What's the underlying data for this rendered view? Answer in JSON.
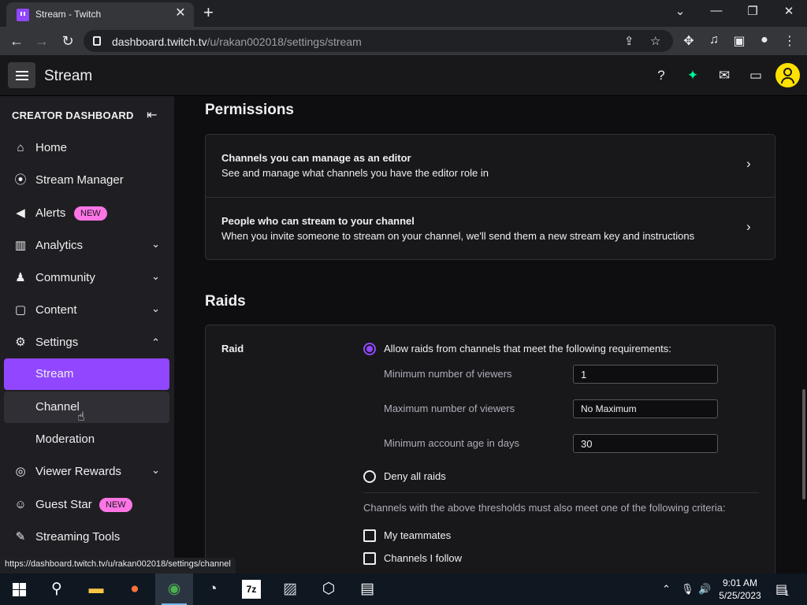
{
  "browser": {
    "tab_title": "Stream - Twitch",
    "url_host": "dashboard.twitch.tv",
    "url_path": "/u/rakan002018/settings/stream",
    "status_url": "https://dashboard.twitch.tv/u/rakan002018/settings/channel"
  },
  "topnav": {
    "title": "Stream"
  },
  "sidebar": {
    "header": "CREATOR DASHBOARD",
    "items": [
      {
        "label": "Home",
        "icon": "home-icon"
      },
      {
        "label": "Stream Manager",
        "icon": "broadcast-icon"
      },
      {
        "label": "Alerts",
        "icon": "megaphone-icon",
        "badge": "NEW"
      },
      {
        "label": "Analytics",
        "icon": "analytics-icon"
      },
      {
        "label": "Community",
        "icon": "community-icon"
      },
      {
        "label": "Content",
        "icon": "content-icon"
      },
      {
        "label": "Settings",
        "icon": "gear-icon"
      },
      {
        "label": "Stream"
      },
      {
        "label": "Channel"
      },
      {
        "label": "Moderation"
      },
      {
        "label": "Viewer Rewards",
        "icon": "rewards-icon"
      },
      {
        "label": "Guest Star",
        "icon": "guest-star-icon",
        "badge": "NEW"
      },
      {
        "label": "Streaming Tools",
        "icon": "tools-icon"
      }
    ]
  },
  "permissions": {
    "heading": "Permissions",
    "rows": [
      {
        "title": "Channels you can manage as an editor",
        "desc": "See and manage what channels you have the editor role in"
      },
      {
        "title": "People who can stream to your channel",
        "desc": "When you invite someone to stream on your channel, we'll send them a new stream key and instructions"
      }
    ]
  },
  "raids": {
    "heading": "Raids",
    "label": "Raid",
    "allow_label": "Allow raids from channels that meet the following requirements:",
    "fields": [
      {
        "label": "Minimum number of viewers",
        "value": "1"
      },
      {
        "label": "Maximum number of viewers",
        "value": "No Maximum"
      },
      {
        "label": "Minimum account age in days",
        "value": "30"
      }
    ],
    "deny_label": "Deny all raids",
    "criteria_text": "Channels with the above thresholds must also meet one of the following criteria:",
    "checkboxes": [
      {
        "label": "My teammates",
        "checked": false
      },
      {
        "label": "Channels I follow",
        "checked": false
      }
    ]
  },
  "taskbar": {
    "time": "9:01 AM",
    "date": "5/25/2023",
    "notification_count": "1"
  },
  "colors": {
    "accent": "#9147ff",
    "badge": "#ff75e6",
    "avatar": "#ffe100"
  }
}
